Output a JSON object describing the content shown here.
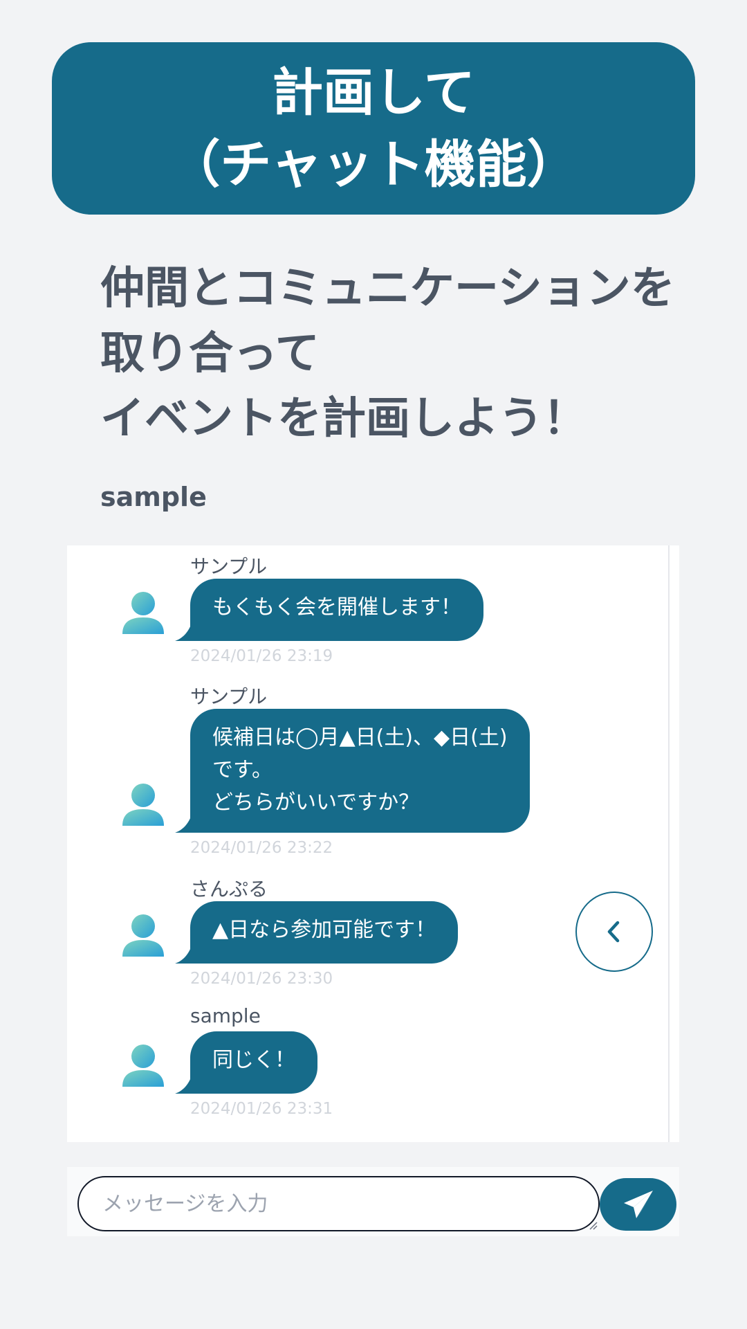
{
  "hero": {
    "title_line1": "計画して",
    "title_line2": "（チャット機能）"
  },
  "lead": {
    "line1": "仲間とコミュニケーションを",
    "line2": "取り合って",
    "line3": "イベントを計画しよう！"
  },
  "current_user": "sample",
  "messages": [
    {
      "sender": "サンプル",
      "lines": [
        "もくもく会を開催します！"
      ],
      "time": "2024/01/26 23:19"
    },
    {
      "sender": "サンプル",
      "lines": [
        "候補日は◯月▲日(土)、◆日(土)",
        "です。",
        "どちらがいいですか？"
      ],
      "time": "2024/01/26 23:22"
    },
    {
      "sender": "さんぷる",
      "lines": [
        "▲日なら参加可能です！"
      ],
      "time": "2024/01/26 23:30"
    },
    {
      "sender": "sample",
      "lines": [
        "同じく！"
      ],
      "time": "2024/01/26 23:31"
    }
  ],
  "composer": {
    "placeholder": "メッセージを入力",
    "value": ""
  },
  "icons": {
    "avatar": "user-avatar-icon",
    "back": "chevron-left-icon",
    "send": "paper-plane-icon"
  },
  "colors": {
    "accent": "#166b8a",
    "heading_text": "#4b5563",
    "background": "#f2f3f5",
    "timestamp": "#d1d5db",
    "avatar_gradient": [
      "#7dd3c0",
      "#2a9fd6"
    ]
  }
}
